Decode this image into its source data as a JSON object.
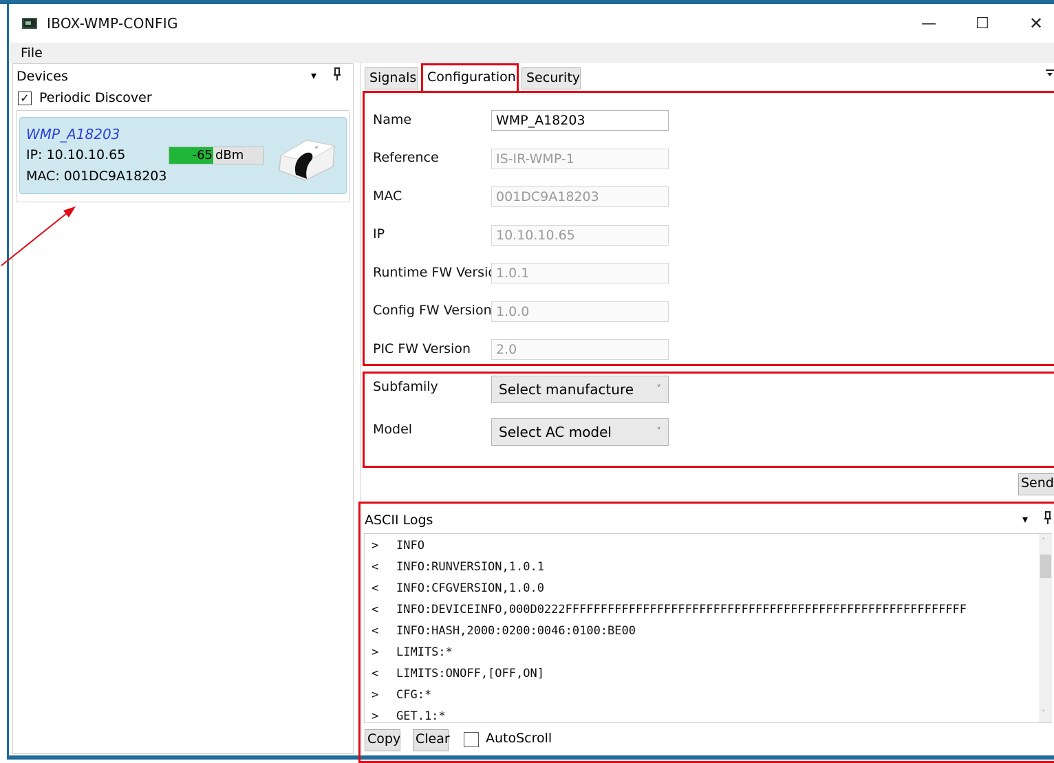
{
  "window": {
    "title": "IBOX-WMP-CONFIG",
    "minimize_glyph": "—",
    "maximize_glyph": "☐",
    "close_glyph": "✕",
    "icon": "app-window-icon"
  },
  "menu": {
    "file": "File"
  },
  "devices_panel": {
    "title": "Devices",
    "dropdown_glyph": "▾",
    "pin_glyph": "📌",
    "periodic_discover": {
      "label": "Periodic Discover",
      "checked": true,
      "check_glyph": "✓"
    },
    "device": {
      "name": "WMP_A18203",
      "ip": "IP: 10.10.10.65",
      "mac": "MAC: 001DC9A18203",
      "rssi": {
        "value": "-65",
        "unit": "dBm",
        "level_percent": 47
      }
    }
  },
  "tabs": [
    {
      "label": "Signals",
      "active": false
    },
    {
      "label": "Configuration",
      "active": true
    },
    {
      "label": "Security",
      "active": false
    }
  ],
  "tabs_menu_glyph": "⊤",
  "configuration": {
    "fields": [
      {
        "label": "Name",
        "value": "WMP_A18203",
        "readonly": false
      },
      {
        "label": "Reference",
        "value": "IS-IR-WMP-1",
        "readonly": true
      },
      {
        "label": "MAC",
        "value": "001DC9A18203",
        "readonly": true
      },
      {
        "label": "IP",
        "value": "10.10.10.65",
        "readonly": true
      },
      {
        "label": "Runtime FW Versio",
        "value": "1.0.1",
        "readonly": true
      },
      {
        "label": "Config FW Version",
        "value": "1.0.0",
        "readonly": true
      },
      {
        "label": "PIC FW Version",
        "value": "2.0",
        "readonly": true
      }
    ],
    "subfamily": {
      "label": "Subfamily",
      "selected": "Select manufacture"
    },
    "model": {
      "label": "Model",
      "selected": "Select AC model"
    },
    "send_label": "Send",
    "chevron_glyph": "˅"
  },
  "logs": {
    "title": "ASCII Logs",
    "lines": [
      {
        "dir": ">",
        "text": "INFO"
      },
      {
        "dir": "<",
        "text": "INFO:RUNVERSION,1.0.1"
      },
      {
        "dir": "<",
        "text": "INFO:CFGVERSION,1.0.0"
      },
      {
        "dir": "<",
        "text": "INFO:DEVICEINFO,000D0222FFFFFFFFFFFFFFFFFFFFFFFFFFFFFFFFFFFFFFFFFFFFFFFFFFFFFFFFF"
      },
      {
        "dir": "<",
        "text": "INFO:HASH,2000:0200:0046:0100:BE00"
      },
      {
        "dir": ">",
        "text": "LIMITS:*"
      },
      {
        "dir": "<",
        "text": "LIMITS:ONOFF,[OFF,ON]"
      },
      {
        "dir": ">",
        "text": "CFG:*"
      },
      {
        "dir": ">",
        "text": "GET.1:*"
      }
    ],
    "copy_label": "Copy",
    "clear_label": "Clear",
    "autoscroll": {
      "label": "AutoScroll",
      "checked": false
    },
    "scroll_up_glyph": "˄",
    "scroll_down_glyph": "˅"
  },
  "colors": {
    "annotation_red": "#e30613",
    "rssi_green": "#1fb63a",
    "device_card_bg": "#cfe8f0",
    "device_name_blue": "#2b3fd6"
  }
}
